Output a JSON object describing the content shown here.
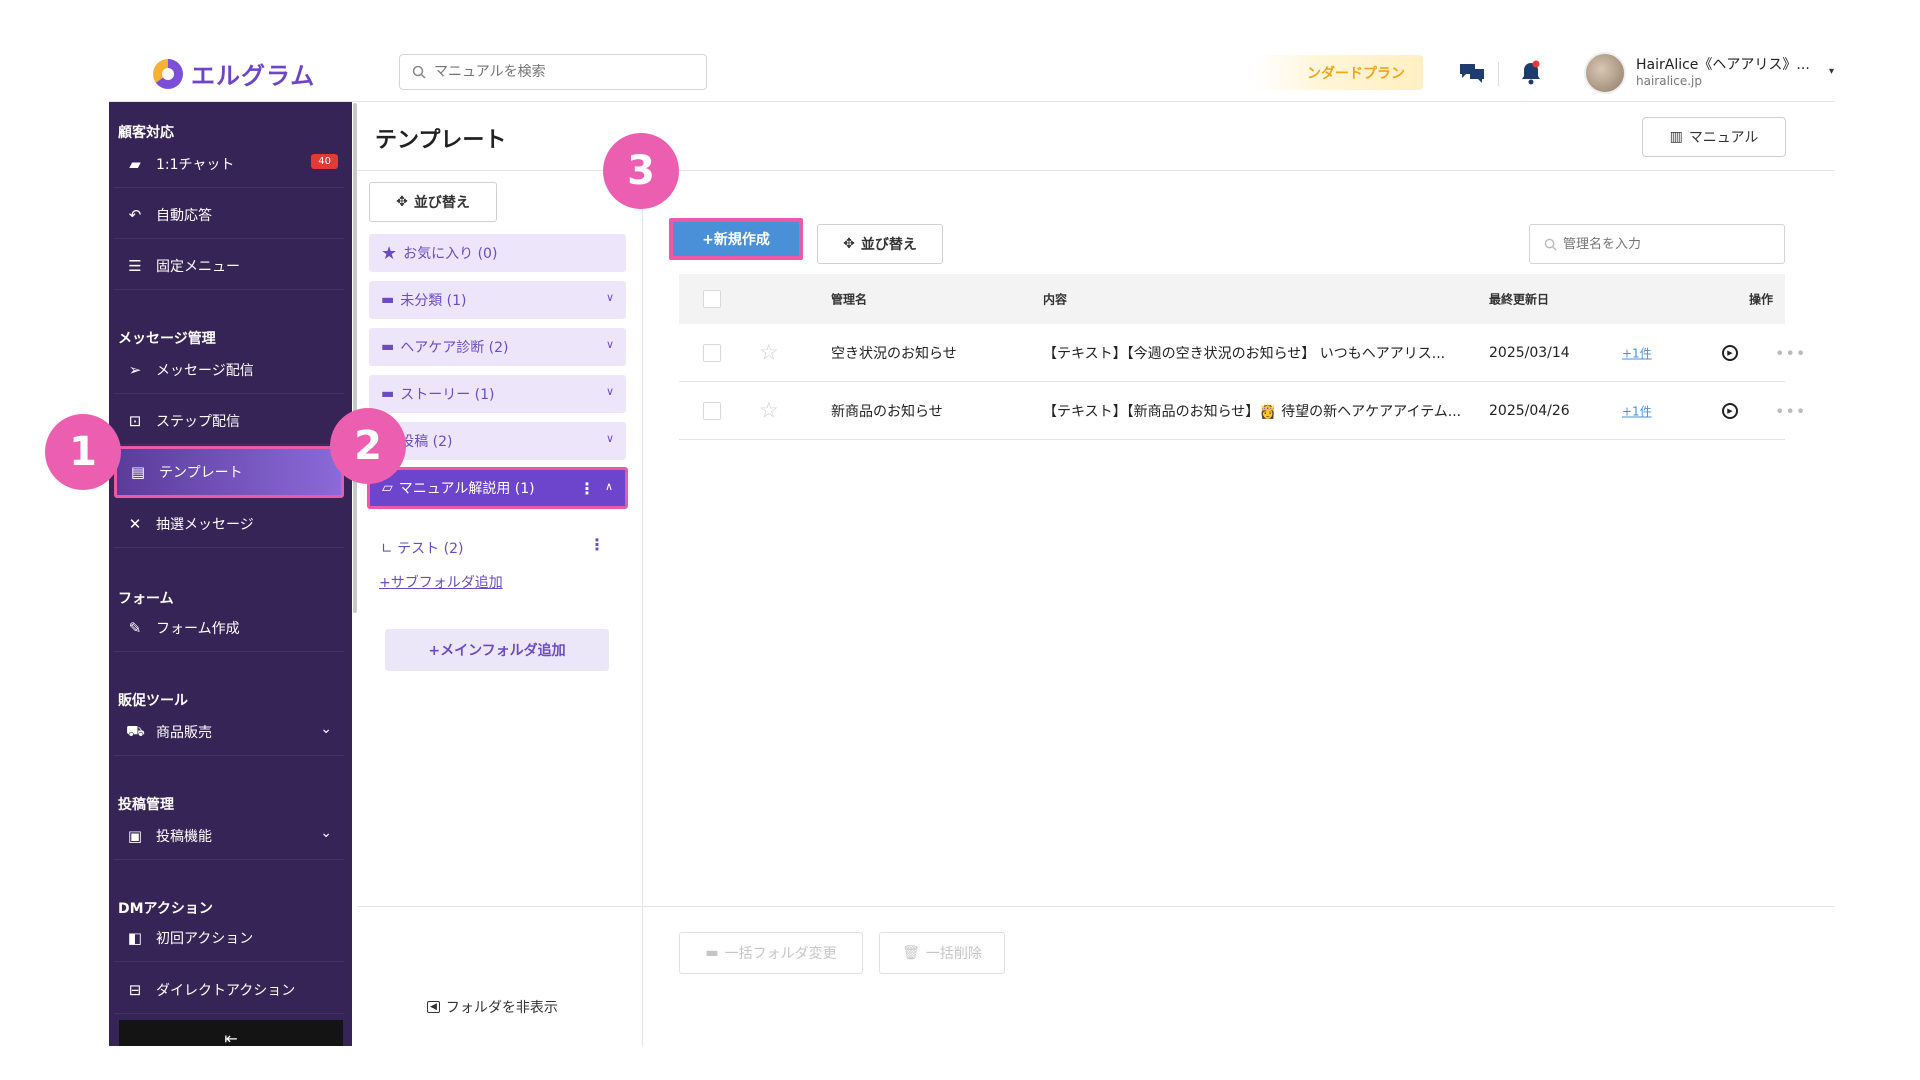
{
  "header": {
    "logo_text": "エルグラム",
    "search_placeholder": "マニュアルを検索",
    "plan_label": "ンダードプラン",
    "user_name": "HairAlice《ヘアアリス》...",
    "user_domain": "hairalice.jp"
  },
  "sidebar": {
    "sections": [
      {
        "title": "顧客対応"
      },
      {
        "title": "メッセージ管理"
      },
      {
        "title": "フォーム"
      },
      {
        "title": "販促ツール"
      },
      {
        "title": "投稿管理"
      },
      {
        "title": "DMアクション"
      }
    ],
    "items": [
      {
        "label": "1:1チャット",
        "badge": "40",
        "icon": "chat-icon"
      },
      {
        "label": "自動応答",
        "icon": "reply-icon"
      },
      {
        "label": "固定メニュー",
        "icon": "menu-icon"
      },
      {
        "label": "メッセージ配信",
        "icon": "send-icon"
      },
      {
        "label": "ステップ配信",
        "icon": "step-icon"
      },
      {
        "label": "テンプレート",
        "icon": "template-icon",
        "active": true
      },
      {
        "label": "抽選メッセージ",
        "icon": "shuffle-icon"
      },
      {
        "label": "フォーム作成",
        "icon": "form-icon"
      },
      {
        "label": "商品販売",
        "icon": "cart-icon"
      },
      {
        "label": "投稿機能",
        "icon": "post-icon"
      },
      {
        "label": "初回アクション",
        "icon": "action-icon"
      },
      {
        "label": "ダイレクトアクション",
        "icon": "direct-icon"
      }
    ],
    "collapse_icon": "collapse-icon"
  },
  "page": {
    "title": "テンプレート",
    "manual_button": "マニュアル"
  },
  "folders": {
    "sort_button": "並び替え",
    "list": [
      {
        "label": "お気に入り (0)",
        "icon": "star-icon"
      },
      {
        "label": "未分類 (1)",
        "icon": "folder-icon"
      },
      {
        "label": "ヘアケア診断 (2)",
        "icon": "folder-icon"
      },
      {
        "label": "ストーリー (1)",
        "icon": "folder-icon"
      },
      {
        "label": "投稿 (2)",
        "icon": "folder-icon"
      },
      {
        "label": "マニュアル解説用 (1)",
        "icon": "folder-open-icon",
        "selected": true
      }
    ],
    "subfolder": "∟ テスト (2)",
    "add_subfolder": "サブフォルダ追加",
    "add_main_folder": "+メインフォルダ追加",
    "hide_folders": "フォルダを非表示"
  },
  "toolbar": {
    "new_button": "+新規作成",
    "sort_button": "並び替え",
    "search_placeholder": "管理名を入力"
  },
  "table": {
    "columns": [
      "管理名",
      "内容",
      "最終更新日",
      "操作"
    ],
    "rows": [
      {
        "name": "空き状況のお知らせ",
        "content": "【テキスト】【今週の空き状況のお知らせ】 いつもヘアアリス...",
        "date": "2025/03/14",
        "link": "+1件"
      },
      {
        "name": "新商品のお知らせ",
        "content": "【テキスト】【新商品のお知らせ】👸 待望の新ヘアケアアイテム...",
        "date": "2025/04/26",
        "link": "+1件"
      }
    ]
  },
  "bulk": {
    "move_folder": "一括フォルダ変更",
    "delete": "一括削除"
  },
  "markers": [
    "1",
    "2",
    "3"
  ],
  "colors": {
    "sidebar_bg": "#362456",
    "accent_purple": "#6d44cc",
    "primary_blue": "#4a90d9",
    "highlight_pink": "#ec5fb0",
    "badge_red": "#e53935"
  }
}
